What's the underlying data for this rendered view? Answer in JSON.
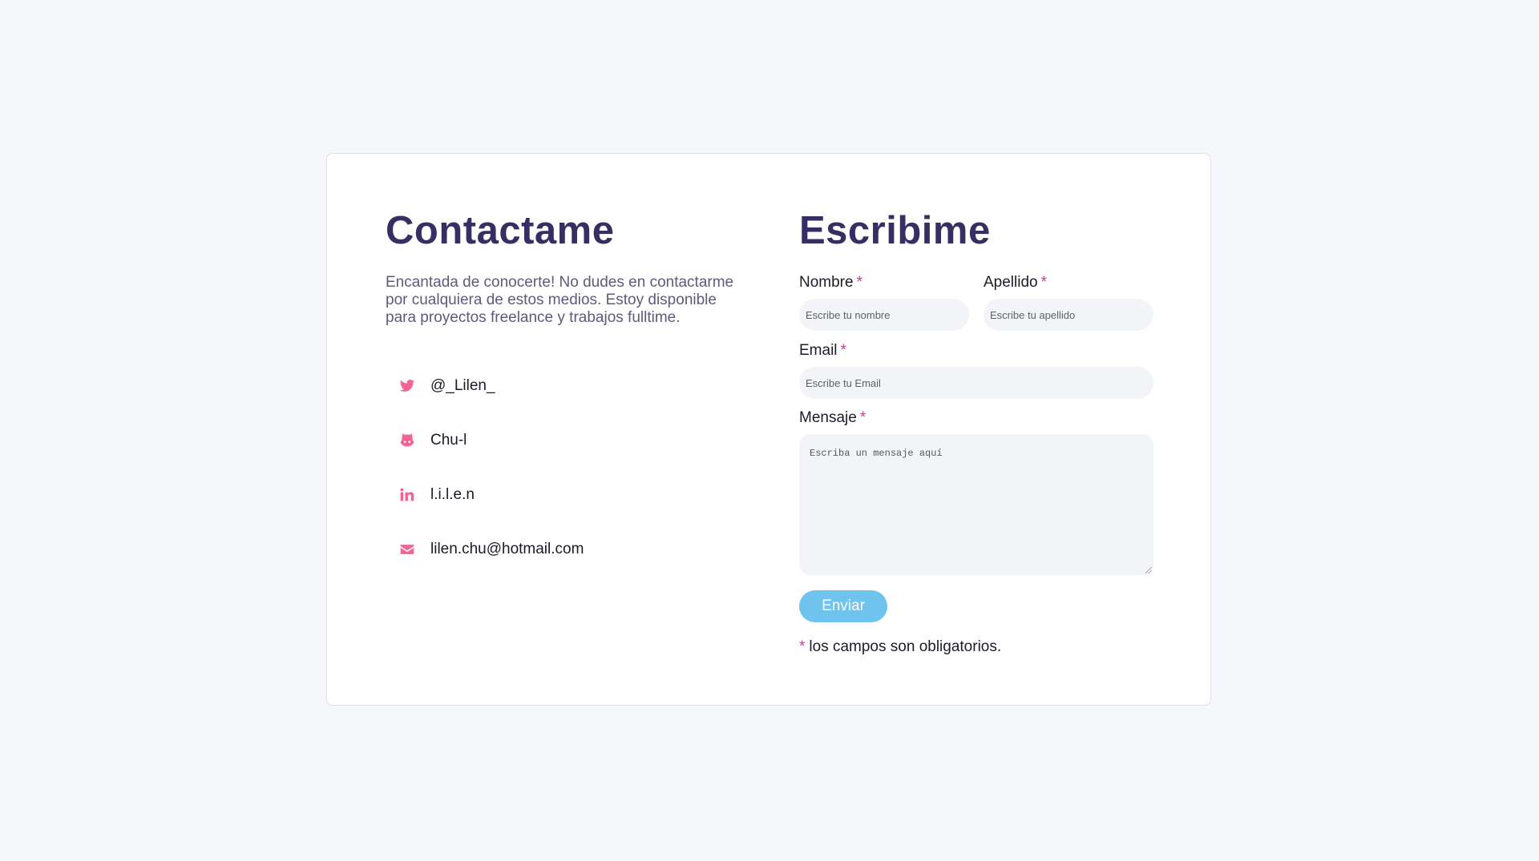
{
  "contact": {
    "title": "Contactame",
    "intro": "Encantada de conocerte! No dudes en contactarme por cualquiera de estos medios. Estoy disponible para proyectos freelance y trabajos fulltime.",
    "items": [
      {
        "icon": "twitter-icon",
        "label": "@_Lilen_"
      },
      {
        "icon": "github-icon",
        "label": "Chu-l"
      },
      {
        "icon": "linkedin-icon",
        "label": "l.i.l.e.n"
      },
      {
        "icon": "envelope-icon",
        "label": "lilen.chu@hotmail.com"
      }
    ]
  },
  "form": {
    "title": "Escribime",
    "required_mark": "*",
    "nombre": {
      "label": "Nombre",
      "placeholder": "Escribe tu nombre"
    },
    "apellido": {
      "label": "Apellido",
      "placeholder": "Escribe tu apellido"
    },
    "email": {
      "label": "Email",
      "placeholder": "Escribe tu Email"
    },
    "mensaje": {
      "label": "Mensaje",
      "placeholder": "Escriba un mensaje aquí"
    },
    "submit_label": "Enviar",
    "required_note": "los campos son obligatorios."
  },
  "colors": {
    "background": "#f6f7fa",
    "heading": "#362f63",
    "accent_icon": "#f06592",
    "required": "#c2428f",
    "button": "#6ec4ef"
  }
}
